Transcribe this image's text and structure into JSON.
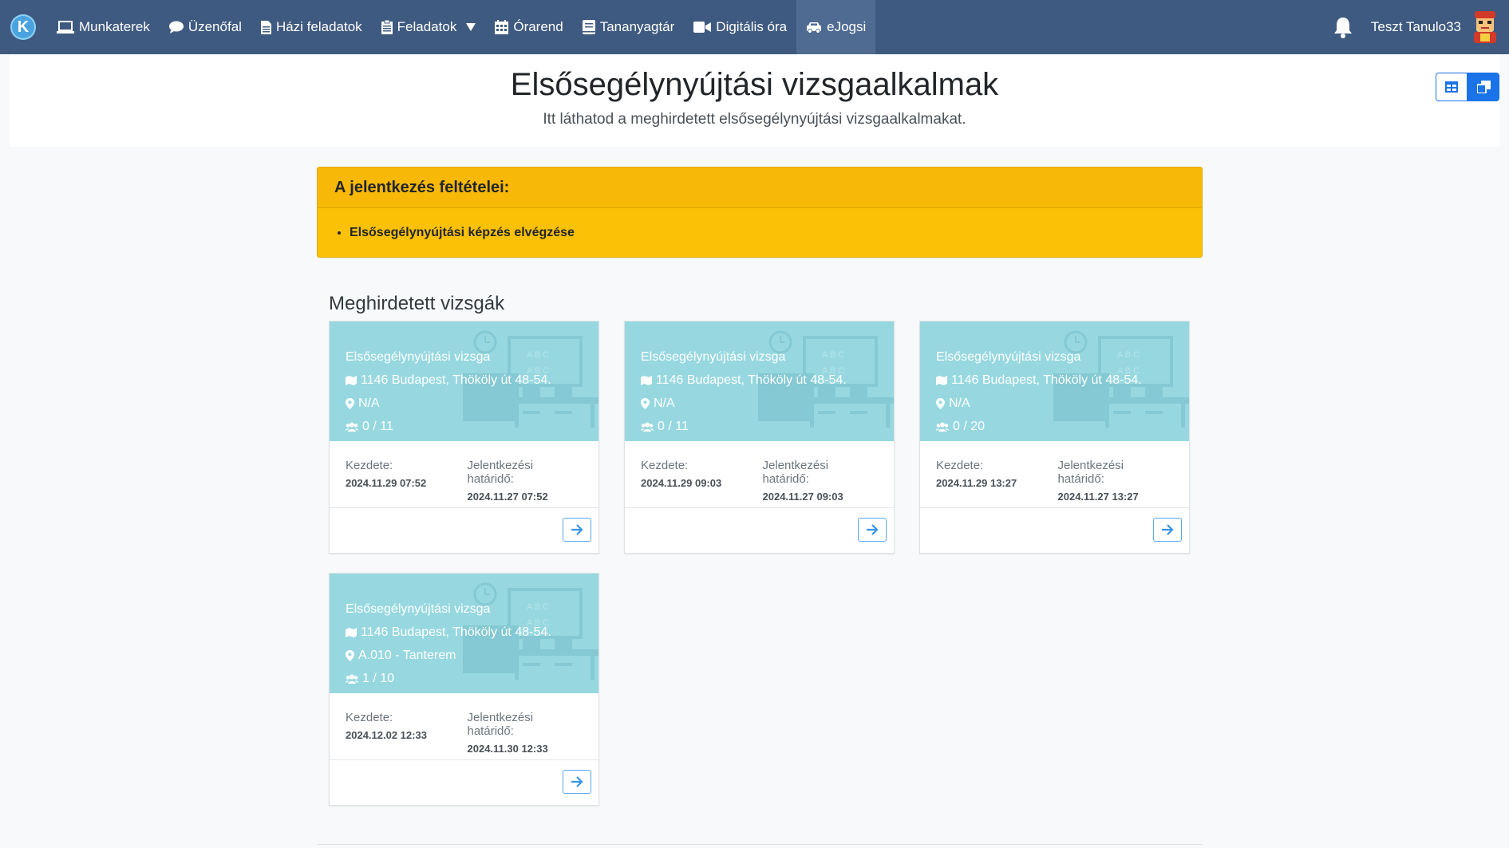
{
  "nav": {
    "brand": "K",
    "items": [
      {
        "label": "Munkaterek",
        "icon": "laptop-icon"
      },
      {
        "label": "Üzenőfal",
        "icon": "comment-icon"
      },
      {
        "label": "Házi feladatok",
        "icon": "file-icon"
      },
      {
        "label": "Feladatok",
        "icon": "clipboard-icon"
      },
      {
        "label": "Órarend",
        "icon": "calendar-icon"
      },
      {
        "label": "Tananyagtár",
        "icon": "book-icon"
      },
      {
        "label": "Digitális óra",
        "icon": "video-icon"
      },
      {
        "label": "eJogsi",
        "icon": "car-icon"
      }
    ],
    "user": "Teszt Tanulo33"
  },
  "header": {
    "title": "Elsősegélynyújtási vizsgaalkalmak",
    "subtitle": "Itt láthatod a meghirdetett elsősegélynyújtási vizsgaalkalmakat."
  },
  "alert": {
    "title": "A jelentkezés feltételei:",
    "items": [
      "Elsősegélynyújtási képzés elvégzése"
    ]
  },
  "section_title": "Meghirdetett vizsgák",
  "cards": [
    {
      "title": "Elsősegélynyújtási vizsga",
      "address": "1146 Budapest, Thököly út 48-54.",
      "room": "N/A",
      "seats": "0 / 11",
      "start_label": "Kezdete:",
      "start": "2024.11.29 07:52",
      "deadline_label": "Jelentkezési határidő:",
      "deadline": "2024.11.27 07:52"
    },
    {
      "title": "Elsősegélynyújtási vizsga",
      "address": "1146 Budapest, Thököly út 48-54.",
      "room": "N/A",
      "seats": "0 / 11",
      "start_label": "Kezdete:",
      "start": "2024.11.29 09:03",
      "deadline_label": "Jelentkezési határidő:",
      "deadline": "2024.11.27 09:03"
    },
    {
      "title": "Elsősegélynyújtási vizsga",
      "address": "1146 Budapest, Thököly út 48-54.",
      "room": "N/A",
      "seats": "0 / 20",
      "start_label": "Kezdete:",
      "start": "2024.11.29 13:27",
      "deadline_label": "Jelentkezési határidő:",
      "deadline": "2024.11.27 13:27"
    },
    {
      "title": "Elsősegélynyújtási vizsga",
      "address": "1146 Budapest, Thököly út 48-54.",
      "room": "A.010 - Tanterem",
      "seats": "1 / 10",
      "start_label": "Kezdete:",
      "start": "2024.12.02 12:33",
      "deadline_label": "Jelentkezési határidő:",
      "deadline": "2024.11.30 12:33"
    }
  ],
  "colors": {
    "navbar": "#3f5a80",
    "alert": "#fbc107",
    "card_top": "#97d8e0",
    "primary": "#1a73e8"
  }
}
